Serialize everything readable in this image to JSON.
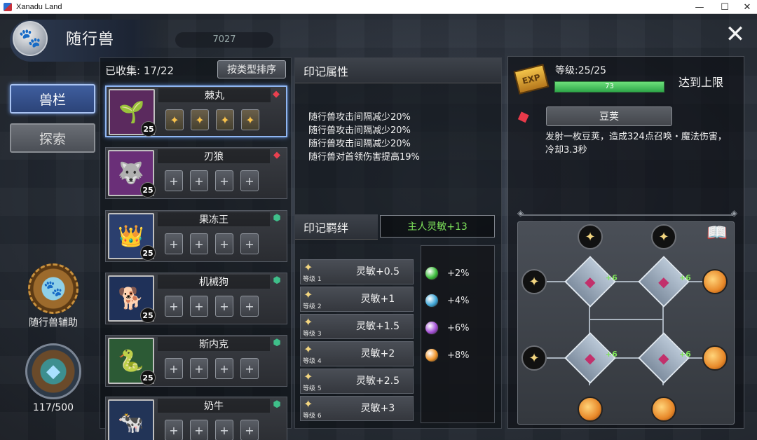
{
  "window": {
    "title": "Xanadu Land",
    "minimize": "—",
    "maximize": "☐",
    "close": "✕"
  },
  "header": {
    "title": "随行兽",
    "energy_value": "7027",
    "close_icon": "✕"
  },
  "nav": {
    "tab_pets": "兽栏",
    "tab_explore": "探索",
    "assist_label": "随行兽辅助",
    "bag_count": "117/500"
  },
  "list": {
    "collected_label": "已收集: 17/22",
    "sort_button": "按类型排序",
    "pets": [
      {
        "name": "棘丸",
        "level": "25",
        "badge": "red-crystal",
        "slots_filled": 4,
        "portrait": "🌱",
        "bg": "#5b2a5e"
      },
      {
        "name": "刃狼",
        "level": "25",
        "badge": "red-crystal",
        "slots_filled": 0,
        "portrait": "🐺",
        "bg": "#6a2f78"
      },
      {
        "name": "果冻王",
        "level": "25",
        "badge": "green-shield",
        "slots_filled": 0,
        "portrait": "👑",
        "bg": "#2b3f6e"
      },
      {
        "name": "机械狗",
        "level": "25",
        "badge": "green-shield",
        "slots_filled": 0,
        "portrait": "🐕",
        "bg": "#1f3159"
      },
      {
        "name": "斯内克",
        "level": "25",
        "badge": "green-shield",
        "slots_filled": 0,
        "portrait": "🐍",
        "bg": "#2c5a35"
      },
      {
        "name": "奶牛",
        "level": "",
        "badge": "green-shield",
        "slots_filled": 0,
        "portrait": "🐄",
        "bg": "#223457"
      }
    ]
  },
  "imprint": {
    "attr_title": "印记属性",
    "attr_lines": [
      "随行兽攻击间隔减少20%",
      "随行兽攻击间隔减少20%",
      "随行兽攻击间隔减少20%",
      "随行兽对首领伤害提高19%"
    ],
    "bond_title": "印记羁绊",
    "master_bonus": "主人灵敏+13",
    "bonds": [
      {
        "level": "等级 1",
        "value": "灵敏+0.5"
      },
      {
        "level": "等级 2",
        "value": "灵敏+1"
      },
      {
        "level": "等级 3",
        "value": "灵敏+1.5"
      },
      {
        "level": "等级 4",
        "value": "灵敏+2"
      },
      {
        "level": "等级 5",
        "value": "灵敏+2.5"
      },
      {
        "level": "等级 6",
        "value": "灵敏+3"
      }
    ],
    "gems": [
      {
        "color": "#3fbf3f",
        "value": "+2%"
      },
      {
        "color": "#3fa7d8",
        "value": "+4%"
      },
      {
        "color": "#a34fd6",
        "value": "+6%"
      },
      {
        "color": "#f0962d",
        "value": "+8%"
      }
    ]
  },
  "detail": {
    "level_label": "等级:25/25",
    "exp_value": "73",
    "exp_fraction": 1.0,
    "maxed_label": "达到上限",
    "exp_badge": "EXP",
    "skill_name": "豆荚",
    "skill_desc": "发射一枚豆荚，造成324点召唤・魔法伤害，冷却3.3秒",
    "hub_plus": "+6"
  },
  "colors": {
    "accent": "#8fb6f2",
    "green": "#7ee35b",
    "exp": "#2fa84a"
  }
}
